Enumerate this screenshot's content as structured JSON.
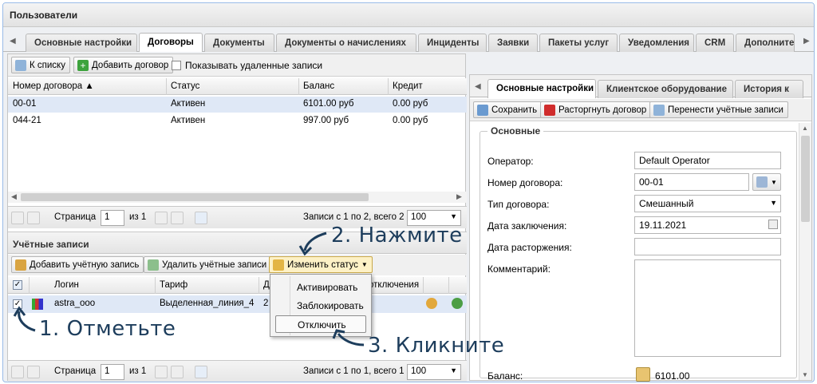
{
  "window_title": "Пользователи",
  "tabs": [
    "Основные настройки",
    "Договоры",
    "Документы",
    "Документы о начислениях",
    "Инциденты",
    "Заявки",
    "Пакеты услуг",
    "Уведомления",
    "CRM",
    "Дополнител"
  ],
  "contracts_toolbar": {
    "to_list": "К списку",
    "add_contract": "Добавить договор",
    "show_deleted": "Показывать удаленные записи"
  },
  "contracts_grid": {
    "columns": [
      "Номер договора",
      "Статус",
      "Баланс",
      "Кредит"
    ],
    "rows": [
      {
        "number": "00-01",
        "status": "Активен",
        "balance": "6101.00 руб",
        "credit": "0.00 руб"
      },
      {
        "number": "044-21",
        "status": "Активен",
        "balance": "997.00 руб",
        "credit": "0.00 руб"
      }
    ]
  },
  "pager_top": {
    "page_label": "Страница",
    "page_value": "1",
    "of_label": "из 1",
    "records": "Записи с 1 по 2, всего 2",
    "size": "100"
  },
  "accounts": {
    "section_title": "Учётные записи",
    "add": "Добавить учётную запись",
    "delete": "Удалить учётные записи",
    "change_status": "Изменить статус",
    "columns": [
      "Логин",
      "Тариф",
      "Д",
      "отключения"
    ],
    "row": {
      "login": "astra_ooo",
      "tariff": "Выделенная_линия_4",
      "d": "2"
    }
  },
  "status_menu": [
    "Активировать",
    "Заблокировать",
    "Отключить"
  ],
  "pager_bottom": {
    "page_label": "Страница",
    "page_value": "1",
    "of_label": "из 1",
    "records": "Записи с 1 по 1, всего 1",
    "size": "100"
  },
  "right_tabs": [
    "Основные настройки",
    "Клиентское оборудование",
    "История к"
  ],
  "right_toolbar": {
    "save": "Сохранить",
    "terminate": "Расторгнуть договор",
    "move": "Перенести учётные записи"
  },
  "form": {
    "section": "Основные",
    "operator_label": "Оператор:",
    "operator_value": "Default Operator",
    "number_label": "Номер договора:",
    "number_value": "00-01",
    "type_label": "Тип договора:",
    "type_value": "Смешанный",
    "date_label": "Дата заключения:",
    "date_value": "19.11.2021",
    "end_label": "Дата расторжения:",
    "end_value": "",
    "comment_label": "Комментарий:",
    "balance_label": "Баланс:",
    "balance_value": "6101.00"
  },
  "annotations": {
    "step1": "1. Отметьте",
    "step2": "2. Нажмите",
    "step3": "3. Кликните"
  },
  "colors": {
    "annotation": "#1d3d5c",
    "tab_border": "#99bbe8"
  }
}
